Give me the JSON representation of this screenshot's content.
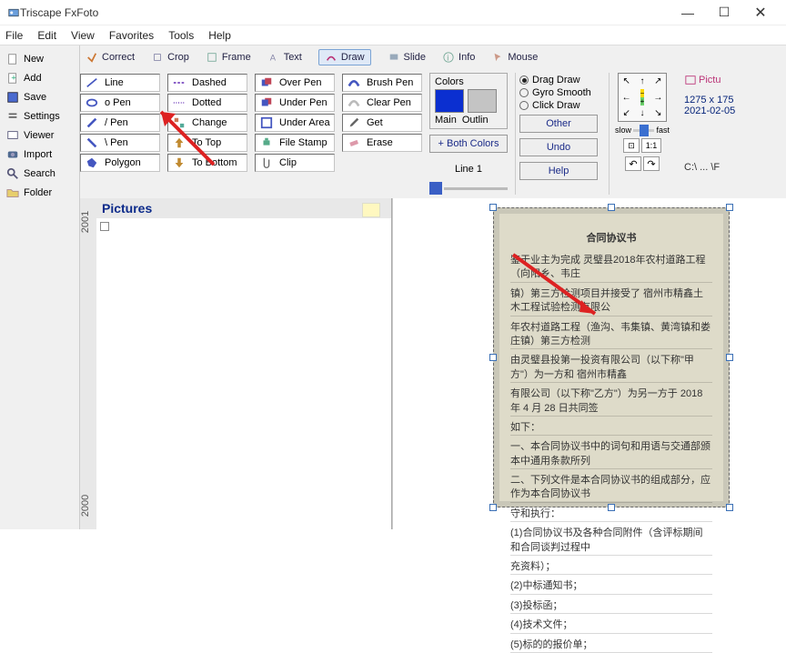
{
  "window": {
    "title": "Triscape FxFoto"
  },
  "menu": [
    "File",
    "Edit",
    "View",
    "Favorites",
    "Tools",
    "Help"
  ],
  "sidebar": {
    "items": [
      {
        "label": "New"
      },
      {
        "label": "Add"
      },
      {
        "label": "Save"
      },
      {
        "label": "Settings"
      },
      {
        "label": "Viewer"
      },
      {
        "label": "Import"
      },
      {
        "label": "Search"
      },
      {
        "label": "Folder"
      }
    ]
  },
  "tabs": [
    "Correct",
    "Crop",
    "Frame",
    "Text",
    "Draw",
    "Slide",
    "Info",
    "Mouse",
    "Pictu"
  ],
  "active_tab": "Draw",
  "tools": {
    "col1": [
      "Line",
      "o Pen",
      "/ Pen",
      "\\ Pen",
      "Polygon"
    ],
    "col2": [
      "Dashed",
      "Dotted",
      "Change",
      "To Top",
      "To Bottom"
    ],
    "col3": [
      "Over Pen",
      "Under Pen",
      "Under Area",
      "File Stamp",
      "Clip"
    ],
    "col4": [
      "Brush Pen",
      "Clear Pen",
      "Get",
      "Erase"
    ]
  },
  "colors": {
    "label": "Colors",
    "main_label": "Main",
    "outline_label": "Outlin",
    "main_hex": "#0b2fd0",
    "outline_hex": "#c4c4c4",
    "both_btn": "+ Both Colors",
    "line_label": "Line 1"
  },
  "radios": [
    "Drag Draw",
    "Gyro Smooth",
    "Click Draw"
  ],
  "buttons": {
    "other": "Other",
    "undo": "Undo",
    "help": "Help"
  },
  "slider": {
    "slow": "slow",
    "fast": "fast",
    "zoom": "1:1"
  },
  "info": {
    "dims": "1275 x 175",
    "date": "2021-02-05",
    "path": "C:\\ ... \\F"
  },
  "pictures": {
    "title": "Pictures"
  },
  "ruler": {
    "top": "2001",
    "bottom": "2000"
  },
  "doc": {
    "title": "合同协议书",
    "lines": [
      "鉴于业主为完成 灵璧县2018年农村道路工程（向阳乡、韦庄",
      "镇）第三方检测项目并接受了 宿州市精鑫土木工程试验检测有限公",
      "年农村道路工程（渔沟、韦集镇、黄湾镇和娄庄镇）第三方检测",
      "由灵璧县投第一投资有限公司（以下称\"甲方\"）为一方和 宿州市精鑫",
      "有限公司（以下称\"乙方\"）为另一方于 2018 年 4 月 28 日共同签",
      "如下：",
      "一、本合同协议书中的词句和用语与交通部颁本中通用条款所列",
      "二、下列文件是本合同协议书的组成部分，应作为本合同协议书",
      "守和执行：",
      "(1)合同协议书及各种合同附件（含评标期间和合同谈判过程中",
      "充资料）；",
      "(2)中标通知书；",
      "(3)投标函；",
      "(4)技术文件；",
      "(5)标的的报价单；"
    ]
  }
}
